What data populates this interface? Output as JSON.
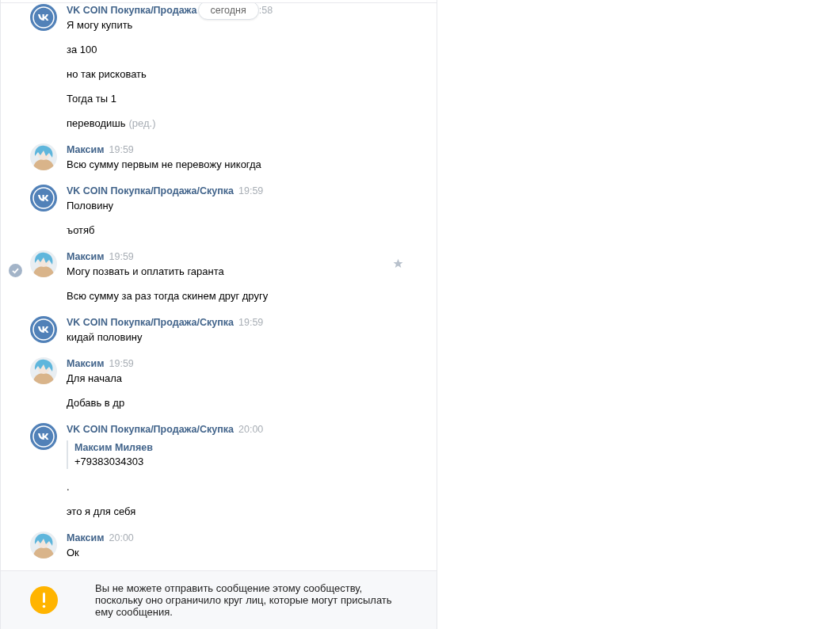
{
  "date_pill": "сегодня",
  "groups": [
    {
      "kind": "community",
      "sender": "VK COIN Покупка/Продажа",
      "time": ":58",
      "selected": false,
      "date_pill_here": true,
      "messages": [
        {
          "text": "Я могу купить"
        },
        {
          "text": "за 100"
        },
        {
          "text": "но так рисковать"
        },
        {
          "text": "Тогда ты 1"
        },
        {
          "text": "переводишь",
          "edited": "(ред.)"
        }
      ]
    },
    {
      "kind": "user",
      "sender": "Максим",
      "time": "19:59",
      "selected": false,
      "messages": [
        {
          "text": "Всю сумму первым не перевожу никогда"
        }
      ]
    },
    {
      "kind": "community",
      "sender": "VK COIN Покупка/Продажа/Скупка",
      "time": "19:59",
      "selected": false,
      "messages": [
        {
          "text": "Половину"
        },
        {
          "text": "ъотяб"
        }
      ]
    },
    {
      "kind": "user",
      "sender": "Максим",
      "time": "19:59",
      "selected": true,
      "messages": [
        {
          "text": "Могу позвать и оплатить гаранта"
        },
        {
          "text": "Всю сумму за раз тогда скинем друг другу"
        }
      ]
    },
    {
      "kind": "community",
      "sender": "VK COIN Покупка/Продажа/Скупка",
      "time": "19:59",
      "selected": false,
      "messages": [
        {
          "text": "кидай половину"
        }
      ]
    },
    {
      "kind": "user",
      "sender": "Максим",
      "time": "19:59",
      "selected": false,
      "messages": [
        {
          "text": "Для начала"
        },
        {
          "text": "Добавь в др"
        }
      ]
    },
    {
      "kind": "community",
      "sender": "VK COIN Покупка/Продажа/Скупка",
      "time": "20:00",
      "selected": false,
      "forward": {
        "sender": "Максим Миляев",
        "text": "+79383034303"
      },
      "messages": [
        {
          "text": "."
        },
        {
          "text": "это я для себя"
        }
      ]
    },
    {
      "kind": "user",
      "sender": "Максим",
      "time": "20:00",
      "selected": false,
      "messages": [
        {
          "text": "Ок"
        }
      ]
    }
  ],
  "notice": "Вы не можете отправить сообщение этому сообществу, поскольку оно ограничило круг лиц, которые могут присылать ему сообщения."
}
